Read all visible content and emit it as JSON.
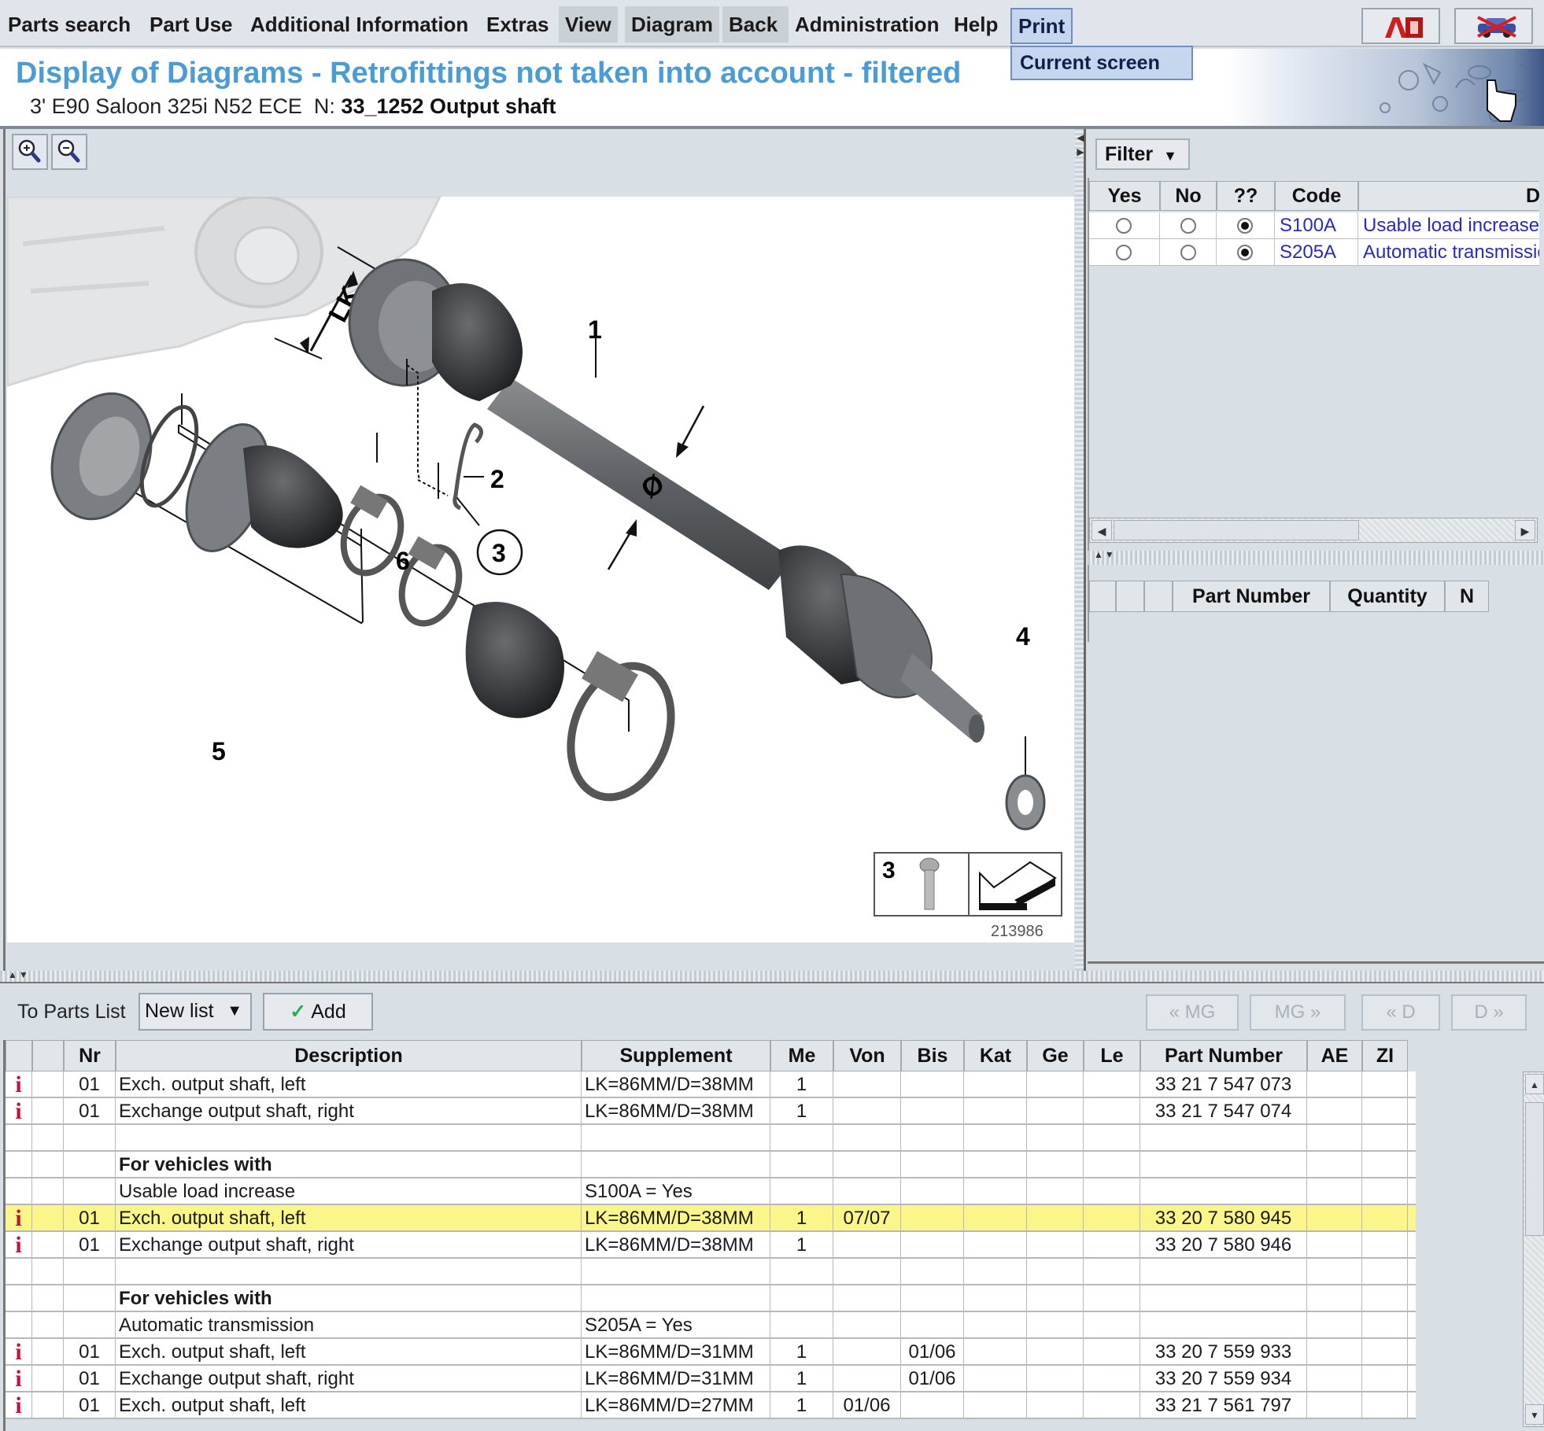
{
  "menubar": {
    "items": [
      "Parts search",
      "Part Use",
      "Additional Information",
      "Extras",
      "View",
      "Diagram",
      "Back",
      "Administration",
      "Help",
      "Print"
    ],
    "print_dropdown": {
      "items": [
        "Current screen"
      ]
    },
    "tool_buttons": [
      {
        "icon": "language-ab-icon",
        "label": "A"
      },
      {
        "icon": "vehicle-crossed-icon"
      }
    ]
  },
  "header": {
    "title": "Display of Diagrams - Retrofittings not taken into account - filtered",
    "vehicle": "3' E90 Saloon 325i N52 ECE",
    "node_prefix": "N:",
    "node": "33_1252 Output shaft"
  },
  "diagram": {
    "zoom_in_icon": "zoom-in-icon",
    "zoom_out_icon": "zoom-out-icon",
    "callouts": [
      "1",
      "2",
      "3",
      "4",
      "5",
      "6"
    ],
    "dimension_label": "LK",
    "diameter_symbol": "Ø",
    "legend_number": "3",
    "image_id": "213986"
  },
  "filter": {
    "button_label": "Filter",
    "columns": [
      "Yes",
      "No",
      "??",
      "Code",
      "D"
    ],
    "rows": [
      {
        "yes": false,
        "no": false,
        "unknown": true,
        "code": "S100A",
        "description": "Usable load increase"
      },
      {
        "yes": false,
        "no": false,
        "unknown": true,
        "code": "S205A",
        "description": "Automatic transmission"
      }
    ]
  },
  "parts_list_panel": {
    "columns": [
      "",
      "",
      "",
      "Part Number",
      "Quantity",
      "N"
    ]
  },
  "parts_toolbar": {
    "to_parts_list_label": "To Parts List",
    "list_select_value": "New list",
    "add_label": "Add",
    "nav": [
      "« MG",
      "MG »",
      "« D",
      "D »"
    ]
  },
  "parts_table": {
    "columns": [
      "",
      "",
      "Nr",
      "Description",
      "Supplement",
      "Me",
      "Von",
      "Bis",
      "Kat",
      "Ge",
      "Le",
      "Part Number",
      "AE",
      "ZI"
    ],
    "rows": [
      {
        "info": true,
        "nr": "01",
        "description": "Exch. output shaft, left",
        "supplement": "LK=86MM/D=38MM",
        "me": "1",
        "von": "",
        "bis": "",
        "part_number": "33 21 7 547 073"
      },
      {
        "info": true,
        "nr": "01",
        "description": "Exchange output shaft, right",
        "supplement": "LK=86MM/D=38MM",
        "me": "1",
        "von": "",
        "bis": "",
        "part_number": "33 21 7 547 074"
      },
      {
        "info": false,
        "nr": "",
        "description": "",
        "supplement": "",
        "me": "",
        "von": "",
        "bis": "",
        "part_number": ""
      },
      {
        "info": false,
        "nr": "",
        "description": "For vehicles with",
        "bold": true,
        "supplement": "",
        "me": "",
        "von": "",
        "bis": "",
        "part_number": ""
      },
      {
        "info": false,
        "nr": "",
        "description": "Usable load increase",
        "supplement": "S100A = Yes",
        "me": "",
        "von": "",
        "bis": "",
        "part_number": ""
      },
      {
        "info": true,
        "nr": "01",
        "description": "Exch. output shaft, left",
        "supplement": "LK=86MM/D=38MM",
        "me": "1",
        "von": "07/07",
        "bis": "",
        "part_number": "33 20 7 580 945",
        "highlighted": true
      },
      {
        "info": true,
        "nr": "01",
        "description": "Exchange output shaft, right",
        "supplement": "LK=86MM/D=38MM",
        "me": "1",
        "von": "",
        "bis": "",
        "part_number": "33 20 7 580 946"
      },
      {
        "info": false,
        "nr": "",
        "description": "",
        "supplement": "",
        "me": "",
        "von": "",
        "bis": "",
        "part_number": ""
      },
      {
        "info": false,
        "nr": "",
        "description": "For vehicles with",
        "bold": true,
        "supplement": "",
        "me": "",
        "von": "",
        "bis": "",
        "part_number": ""
      },
      {
        "info": false,
        "nr": "",
        "description": "Automatic transmission",
        "supplement": "S205A = Yes",
        "me": "",
        "von": "",
        "bis": "",
        "part_number": ""
      },
      {
        "info": true,
        "nr": "01",
        "description": "Exch. output shaft, left",
        "supplement": "LK=86MM/D=31MM",
        "me": "1",
        "von": "",
        "bis": "01/06",
        "part_number": "33 20 7 559 933"
      },
      {
        "info": true,
        "nr": "01",
        "description": "Exchange output shaft, right",
        "supplement": "LK=86MM/D=31MM",
        "me": "1",
        "von": "",
        "bis": "01/06",
        "part_number": "33 20 7 559 934"
      },
      {
        "info": true,
        "nr": "01",
        "description": "Exch. output shaft, left",
        "supplement": "LK=86MM/D=27MM",
        "me": "1",
        "von": "01/06",
        "bis": "",
        "part_number": "33 21 7 561 797"
      }
    ]
  },
  "colors": {
    "title_blue": "#4b9cd5",
    "highlight_row": "#fbf68a",
    "info_icon": "#c0143c",
    "link_blue": "#2a2ab8",
    "menu_active": "#c5d6ee"
  }
}
